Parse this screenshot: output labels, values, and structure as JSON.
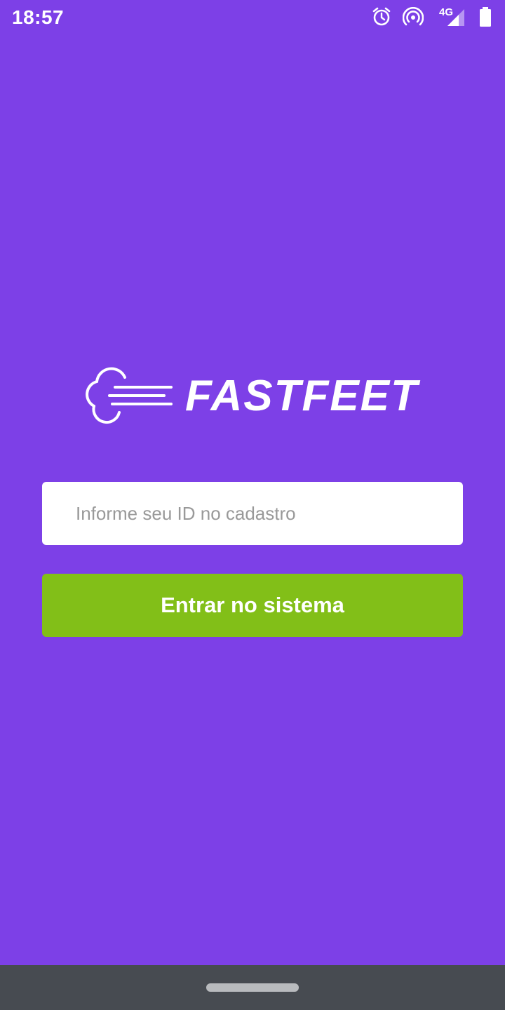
{
  "status_bar": {
    "time": "18:57",
    "network_label": "4G",
    "icons": [
      "alarm-icon",
      "hotspot-icon",
      "cell-signal-icon",
      "battery-icon"
    ]
  },
  "logo": {
    "text": "FASTFEET",
    "icon": "fast-cloud-icon"
  },
  "login_form": {
    "id_input": {
      "placeholder": "Informe seu ID no cadastro",
      "value": ""
    },
    "submit_label": "Entrar no sistema"
  },
  "colors": {
    "background": "#7D40E7",
    "button": "#82BF18",
    "input_background": "#FFFFFF",
    "nav_bar": "#474B51"
  }
}
